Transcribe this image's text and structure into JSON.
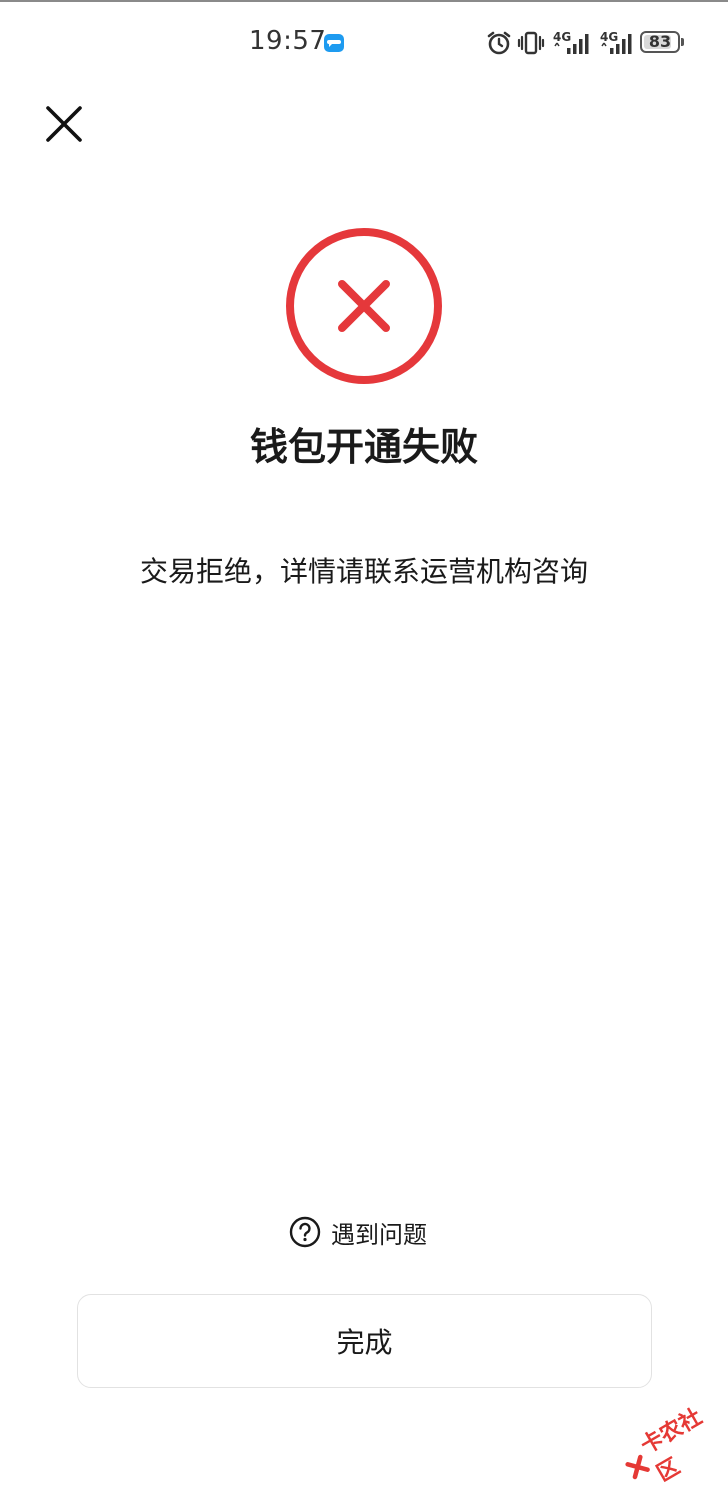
{
  "status_bar": {
    "time": "19:57",
    "network_1": "4G",
    "network_2": "4G",
    "battery_level": "83",
    "battery_fraction": 0.83,
    "icons": [
      "message-app-icon",
      "alarm-icon",
      "vibrate-icon",
      "signal-icon",
      "signal-icon",
      "battery-icon"
    ]
  },
  "header": {
    "close_icon": "close-icon"
  },
  "result": {
    "status_icon": "error-circle-icon",
    "status_color": "#e5383b",
    "title": "钱包开通失败",
    "message": "交易拒绝，详情请联系运营机构咨询"
  },
  "footer": {
    "help_icon": "question-circle-icon",
    "help_label": "遇到问题",
    "done_label": "完成"
  },
  "watermark": {
    "text": "卡农社区",
    "logo_icon": "kanong-logo-icon"
  }
}
